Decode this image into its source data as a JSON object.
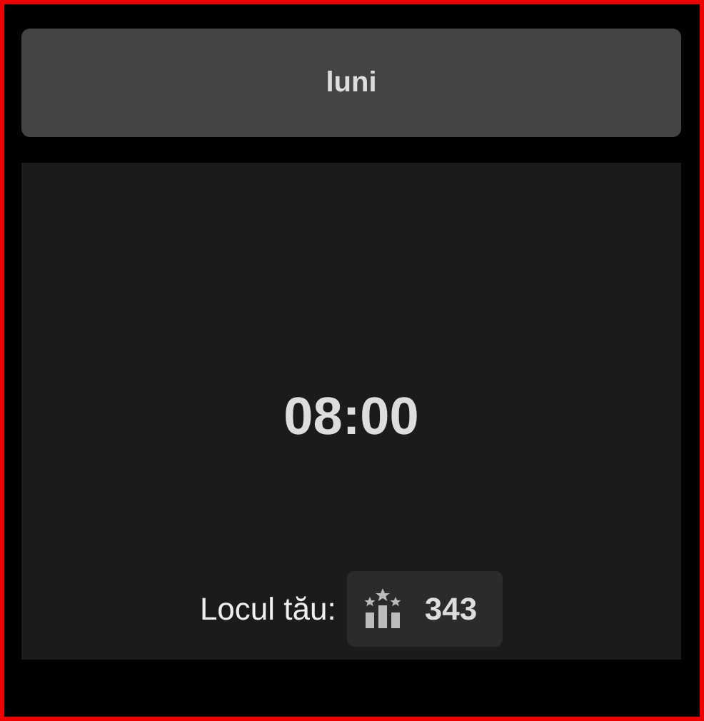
{
  "day_button": {
    "label": "luni"
  },
  "time": "08:00",
  "rank": {
    "label": "Locul tău:",
    "value": "343"
  }
}
